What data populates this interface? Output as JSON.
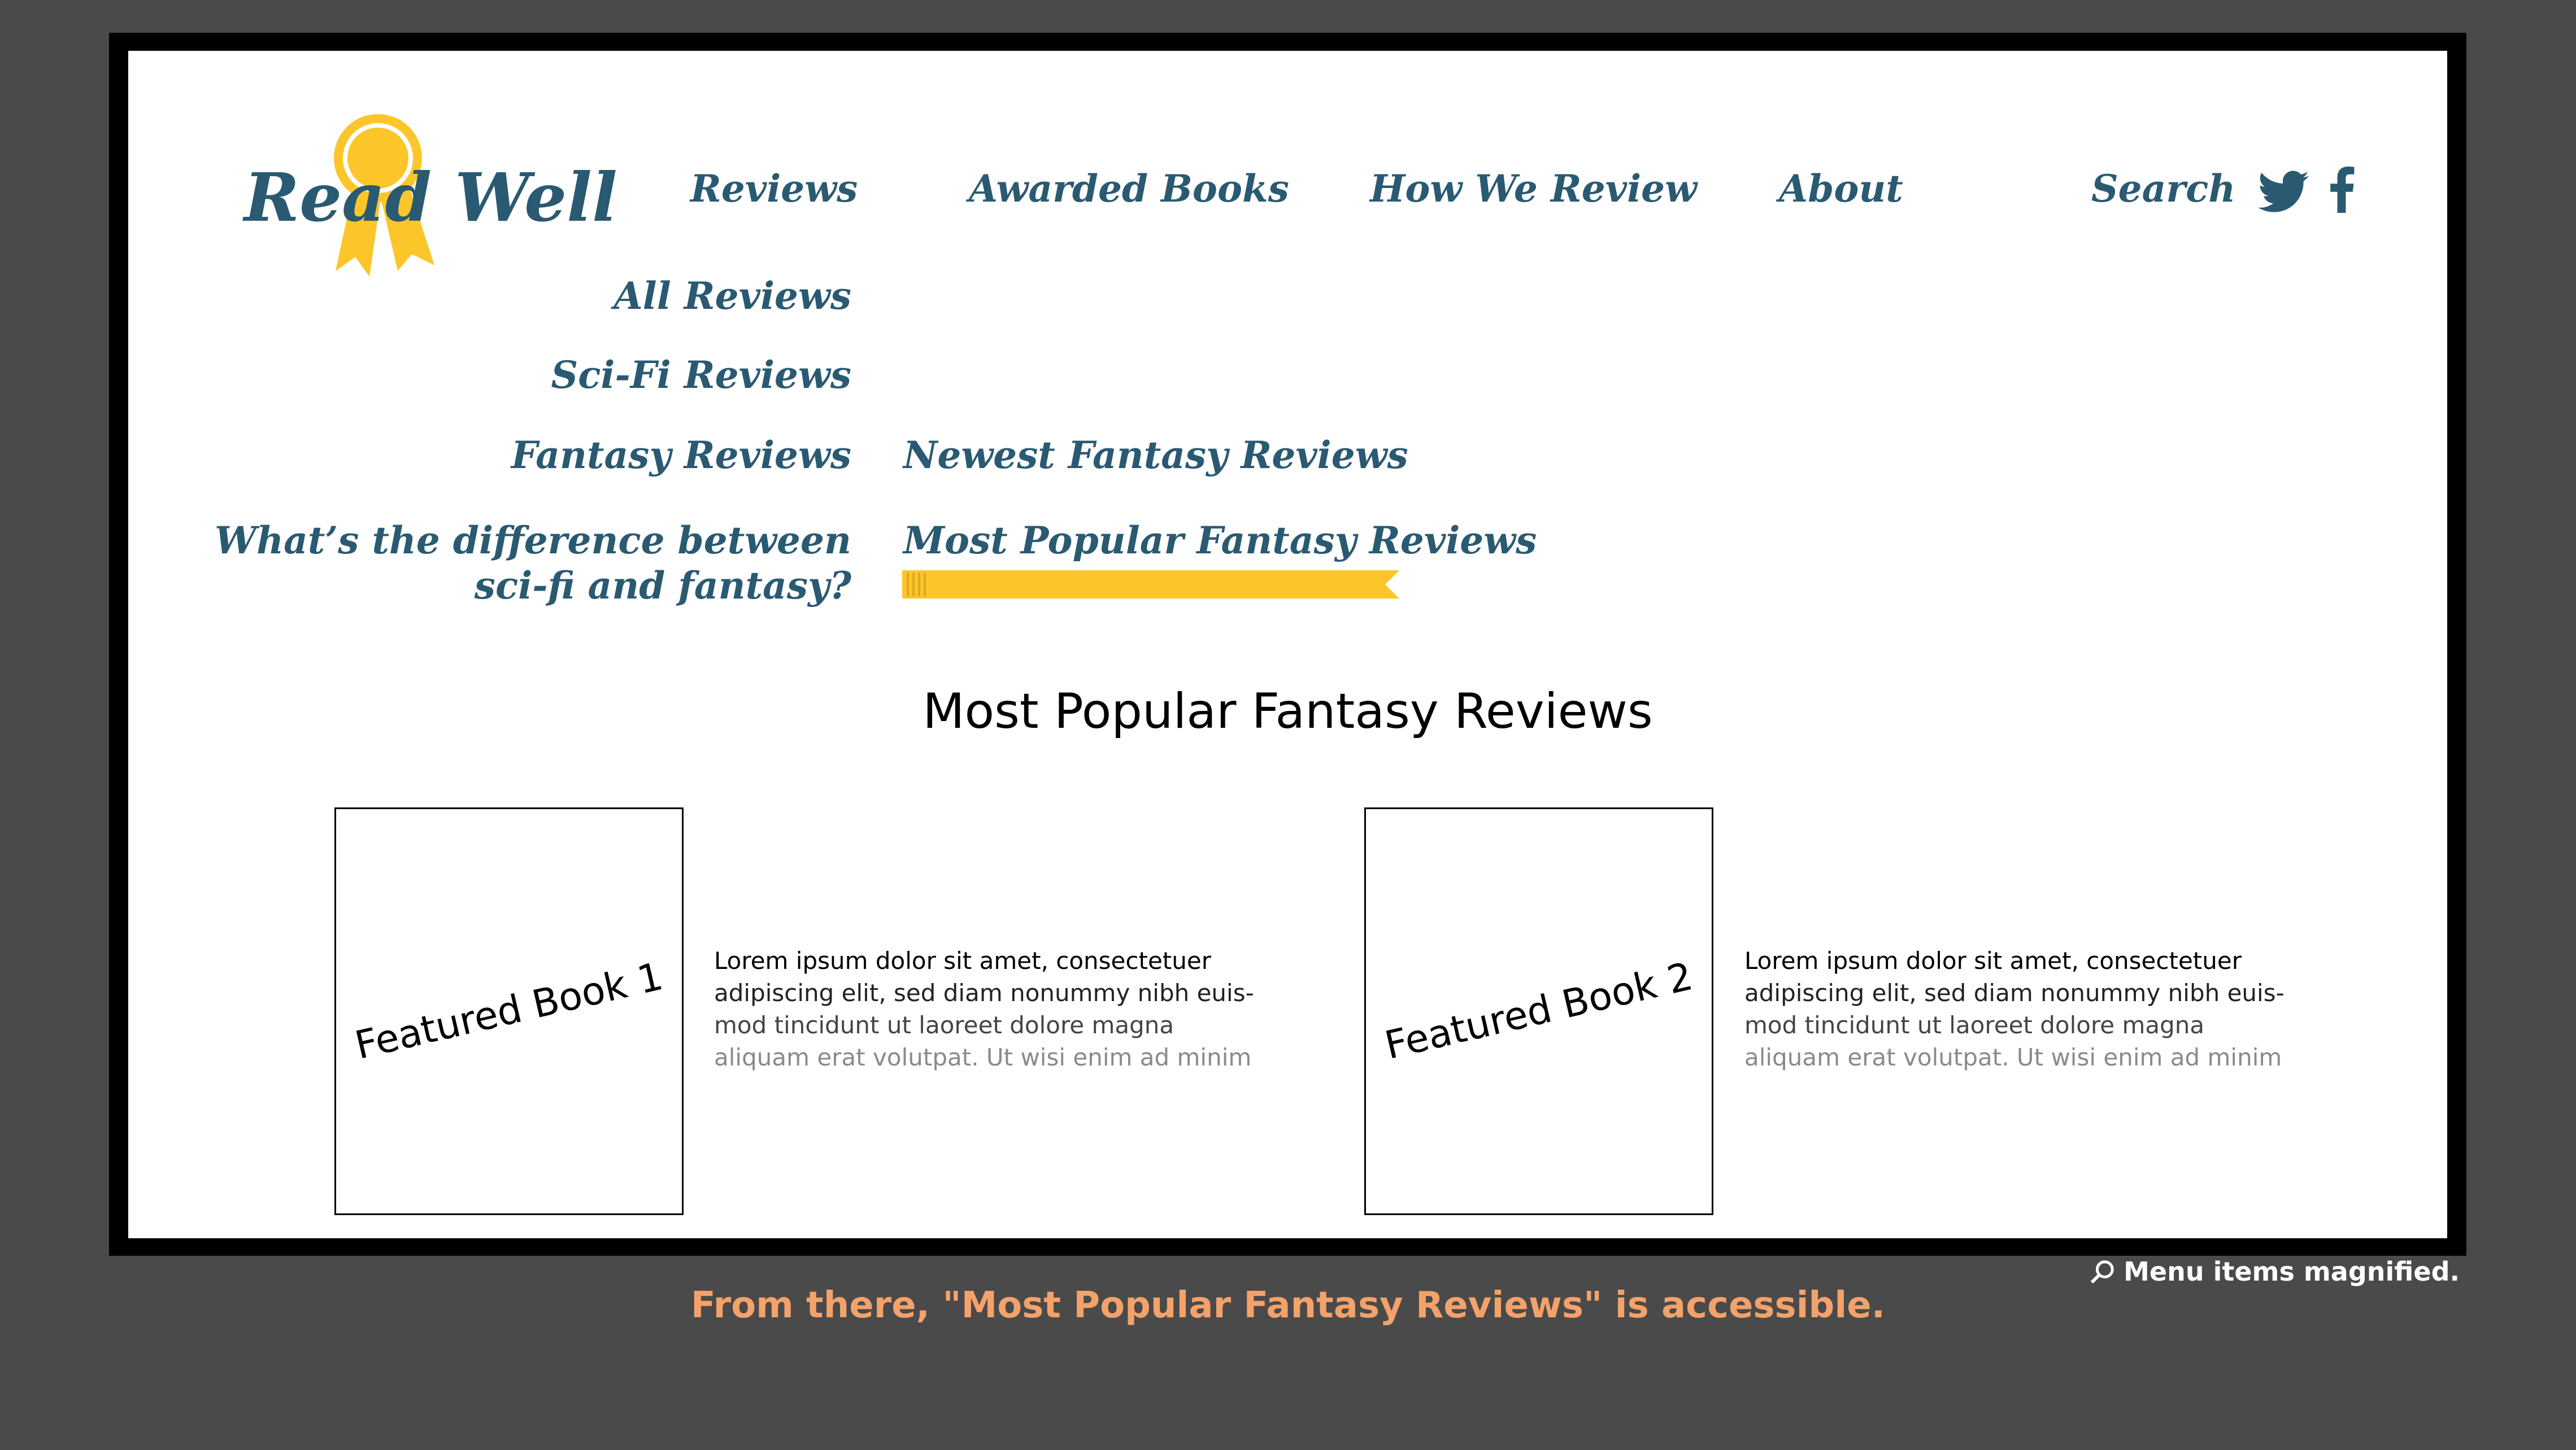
{
  "logo": {
    "text": "Read Well"
  },
  "nav": {
    "reviews": "Reviews",
    "awarded_books": "Awarded Books",
    "how_we_review": "How We Review",
    "about": "About",
    "search": "Search"
  },
  "social": {
    "twitter_icon": "twitter-icon",
    "facebook_icon": "facebook-icon"
  },
  "reviews_menu": {
    "all": "All Reviews",
    "scifi": "Sci-Fi Reviews",
    "fantasy": "Fantasy Reviews",
    "difference_line1": "What’s the difference between",
    "difference_line2": "sci-fi and fantasy?"
  },
  "fantasy_menu": {
    "newest": "Newest Fantasy Reviews",
    "most_popular": "Most Popular Fantasy Reviews"
  },
  "main": {
    "title": "Most Popular Fantasy Reviews",
    "books": [
      {
        "label": "Featured Book 1",
        "lines": [
          "Lorem ipsum dolor sit amet, consectetuer",
          "adipiscing elit, sed diam nonummy nibh euis-",
          "mod tincidunt ut laoreet dolore magna",
          "aliquam erat volutpat. Ut wisi enim ad minim"
        ]
      },
      {
        "label": "Featured Book 2",
        "lines": [
          "Lorem ipsum dolor sit amet, consectetuer",
          "adipiscing elit, sed diam nonummy nibh euis-",
          "mod tincidunt ut laoreet dolore magna",
          "aliquam erat volutpat. Ut wisi enim ad minim"
        ]
      }
    ]
  },
  "annotation": {
    "magnified_note": "Menu items magnified.",
    "caption": "From there, \"Most Popular Fantasy Reviews\" is accessible."
  },
  "colors": {
    "brand_text": "#2a5a72",
    "ribbon_yellow": "#fcc62a",
    "caption_orange": "#f4a26a"
  }
}
